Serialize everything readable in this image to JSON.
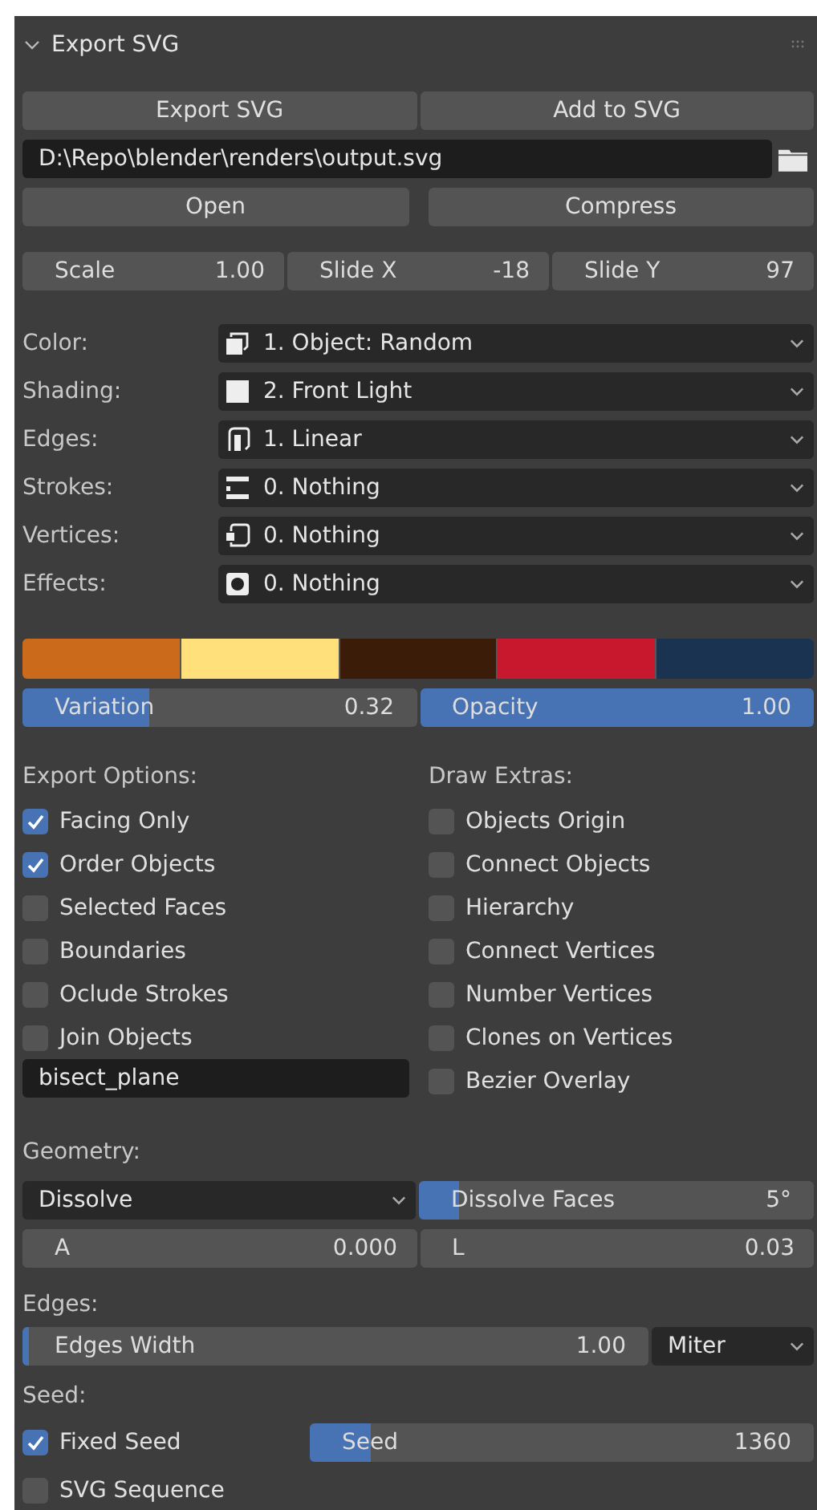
{
  "panel": {
    "title": "Export SVG",
    "expanded": true
  },
  "actions": [
    "Export SVG",
    "Add to SVG"
  ],
  "file_path": {
    "value": "D:\\Repo\\blender\\renders\\output.svg"
  },
  "file_actions": [
    "Open",
    "Compress"
  ],
  "transform": [
    {
      "label": "Scale",
      "value": "1.00"
    },
    {
      "label": "Slide X",
      "value": "-18"
    },
    {
      "label": "Slide Y",
      "value": "97"
    }
  ],
  "style_settings": [
    {
      "label": "Color:",
      "value": "1. Object: Random"
    },
    {
      "label": "Shading:",
      "value": "2. Front Light"
    },
    {
      "label": "Edges:",
      "value": "1. Linear"
    },
    {
      "label": "Strokes:",
      "value": "0. Nothing"
    },
    {
      "label": "Vertices:",
      "value": "0. Nothing"
    },
    {
      "label": "Effects:",
      "value": "0. Nothing"
    }
  ],
  "palette": [
    {
      "color": "#cc6a1c"
    },
    {
      "color": "#ffe07a"
    },
    {
      "color": "#3a1c08"
    },
    {
      "color": "#c8182e"
    },
    {
      "color": "#1a3350"
    }
  ],
  "blend_sliders": [
    {
      "label": "Variation",
      "value": "0.32",
      "level": 0.32
    },
    {
      "label": "Opacity",
      "value": "1.00",
      "level": 1.0
    }
  ],
  "export_options": {
    "title": "Export Options:",
    "items": [
      {
        "label": "Facing Only",
        "checked": true
      },
      {
        "label": "Order Objects",
        "checked": true
      },
      {
        "label": "Selected Faces",
        "checked": false
      },
      {
        "label": "Boundaries",
        "checked": false
      },
      {
        "label": "Oclude Strokes",
        "checked": false
      },
      {
        "label": "Join Objects",
        "checked": false
      }
    ],
    "field": {
      "value": "bisect_plane"
    }
  },
  "draw_extras": {
    "title": "Draw Extras:",
    "items": [
      {
        "label": "Objects Origin",
        "checked": false
      },
      {
        "label": "Connect Objects",
        "checked": false
      },
      {
        "label": "Hierarchy",
        "checked": false
      },
      {
        "label": "Connect Vertices",
        "checked": false
      },
      {
        "label": "Number Vertices",
        "checked": false
      },
      {
        "label": "Clones on Vertices",
        "checked": false
      },
      {
        "label": "Bezier Overlay",
        "checked": false
      }
    ]
  },
  "geometry": {
    "title": "Geometry:",
    "mode": {
      "value": "Dissolve"
    },
    "dissolve_faces": {
      "label": "Dissolve Faces",
      "value": "5°",
      "level": 0.1
    },
    "numbers": [
      {
        "label": "A",
        "value": "0.000"
      },
      {
        "label": "L",
        "value": "0.03"
      }
    ]
  },
  "edges": {
    "title": "Edges:",
    "width": {
      "label": "Edges Width",
      "value": "1.00",
      "level": 0.01
    },
    "join": {
      "value": "Miter"
    }
  },
  "seed": {
    "title": "Seed:",
    "fixed_seed": {
      "label": "Fixed Seed",
      "checked": true
    },
    "seed": {
      "label": "Seed",
      "value": "1360",
      "level": 0.12
    },
    "svg_sequence": {
      "label": "SVG Sequence",
      "checked": false
    }
  }
}
